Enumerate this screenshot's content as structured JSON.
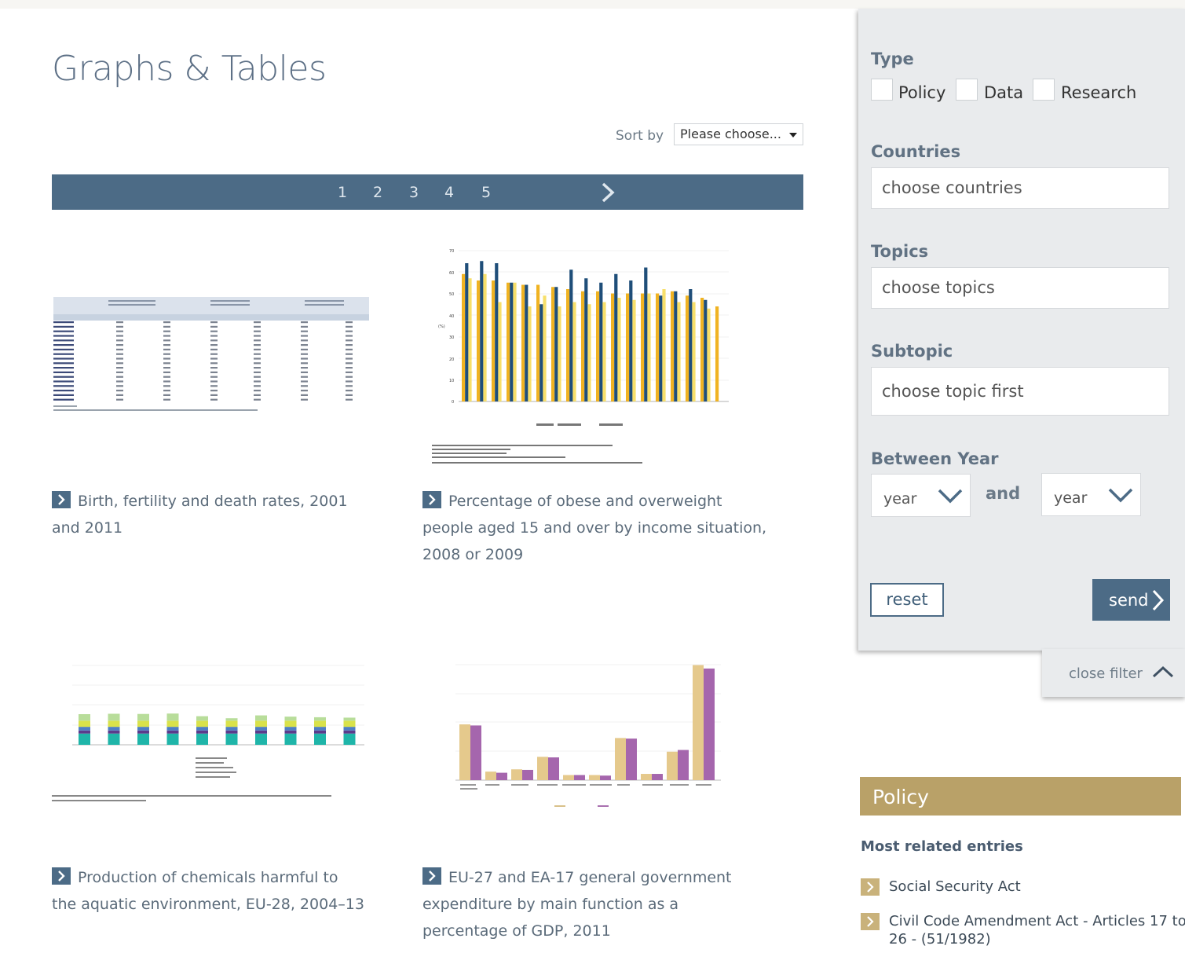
{
  "page": {
    "title": "Graphs & Tables"
  },
  "sort": {
    "label": "Sort by",
    "selected": "Please choose..."
  },
  "pagination": {
    "pages": [
      "1",
      "2",
      "3",
      "4",
      "5"
    ],
    "next_icon": "chevron-right-icon"
  },
  "cards": [
    {
      "title": "Birth, fertility and death rates, 2001 and 2011"
    },
    {
      "title": "Percentage of obese and overweight people aged 15 and over by income situation, 2008 or 2009"
    },
    {
      "title": "Production of chemicals harmful to the aquatic environment, EU-28, 2004–13"
    },
    {
      "title": "EU-27 and EA-17 general government expenditure by main function as a percentage of GDP, 2011"
    }
  ],
  "filter": {
    "type_heading": "Type",
    "type_options": [
      "Policy",
      "Data",
      "Research"
    ],
    "countries_heading": "Countries",
    "countries_placeholder": "choose countries",
    "topics_heading": "Topics",
    "topics_placeholder": "choose topics",
    "subtopic_heading": "Subtopic",
    "subtopic_placeholder": "choose topic first",
    "year_heading": "Between Year",
    "year_from": "year",
    "and_label": "and",
    "year_to": "year",
    "reset_label": "reset",
    "send_label": "send",
    "close_label": "close filter"
  },
  "policy": {
    "heading": "Policy",
    "related_heading": "Most related entries",
    "entries": [
      "Social Security Act",
      "Civil Code Amendment Act - Articles 17 to 26 - (51/1982)"
    ]
  },
  "colors": {
    "accent_blue": "#4c6b86",
    "policy_gold": "#b9a168",
    "panel_gray": "#e9ebed"
  }
}
